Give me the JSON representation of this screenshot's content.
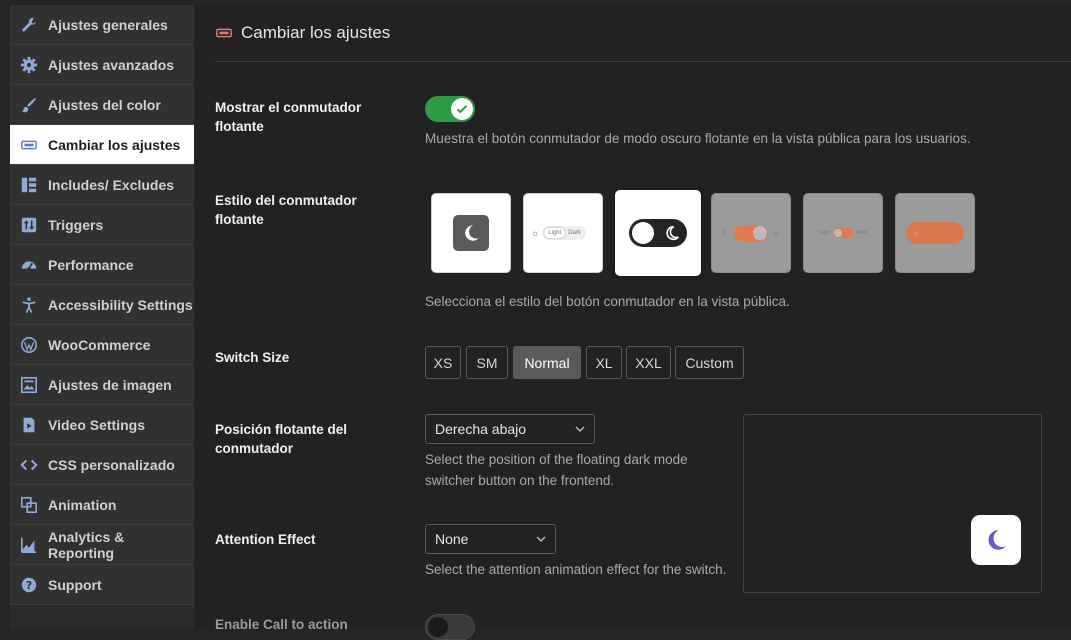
{
  "sidebar": {
    "items": [
      {
        "label": "Ajustes generales",
        "icon": "wrench-icon"
      },
      {
        "label": "Ajustes avanzados",
        "icon": "gear-icon"
      },
      {
        "label": "Ajustes del color",
        "icon": "paintbrush-icon"
      },
      {
        "label": "Cambiar los ajustes",
        "icon": "switch-icon",
        "active": true
      },
      {
        "label": "Includes/ Excludes",
        "icon": "grid-icon"
      },
      {
        "label": "Triggers",
        "icon": "triggers-icon"
      },
      {
        "label": "Performance",
        "icon": "gauge-icon"
      },
      {
        "label": "Accessibility Settings",
        "icon": "accessibility-icon"
      },
      {
        "label": "WooCommerce",
        "icon": "wordpress-icon"
      },
      {
        "label": "Ajustes de imagen",
        "icon": "image-icon"
      },
      {
        "label": "Video Settings",
        "icon": "video-icon"
      },
      {
        "label": "CSS personalizado",
        "icon": "code-icon"
      },
      {
        "label": "Animation",
        "icon": "animation-icon"
      },
      {
        "label": "Analytics & Reporting",
        "icon": "chart-icon"
      },
      {
        "label": "Support",
        "icon": "help-icon"
      }
    ]
  },
  "header": {
    "title": "Cambiar los ajustes",
    "icon": "switch-icon"
  },
  "floating_switch": {
    "label": "Mostrar el conmutador flotante",
    "enabled": true,
    "description": "Muestra el botón conmutador de modo oscuro flotante en la vista pública para los usuarios."
  },
  "switch_style": {
    "label": "Estilo del conmutador flotante",
    "description": "Selecciona el estilo del botón conmutador en la vista pública.",
    "light_text": "Light",
    "dark_text": "Dark",
    "selected_index": 2
  },
  "switch_size": {
    "label": "Switch Size",
    "options": [
      "XS",
      "SM",
      "Normal",
      "XL",
      "XXL",
      "Custom"
    ],
    "selected": "Normal"
  },
  "position": {
    "label": "Posición flotante del conmutador",
    "value": "Derecha abajo",
    "description": "Select the position of the floating dark mode switcher button on the frontend."
  },
  "attention": {
    "label": "Attention Effect",
    "value": "None",
    "description": "Select the attention animation effect for the switch."
  },
  "cta": {
    "label": "Enable Call to action",
    "enabled": false
  },
  "colors": {
    "toggle_on": "#2e9c45",
    "moon_accent": "#6a5acd",
    "orange": "#e07a4f"
  }
}
